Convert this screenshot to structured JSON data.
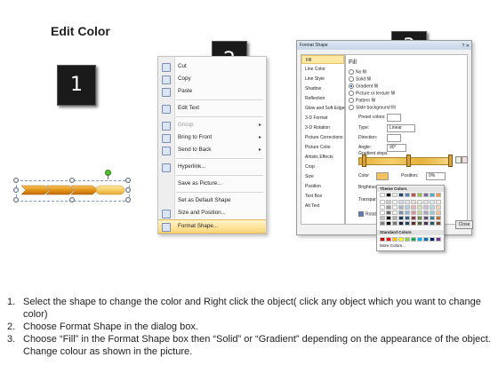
{
  "title": "Edit Color",
  "badges": [
    "1",
    "2",
    "3"
  ],
  "context_menu": {
    "items": [
      {
        "label": "Cut",
        "disabled": false
      },
      {
        "label": "Copy",
        "disabled": false
      },
      {
        "label": "Paste",
        "disabled": false
      },
      {
        "label": "Edit Text",
        "disabled": false
      },
      {
        "label": "Group",
        "disabled": true,
        "submenu": true
      },
      {
        "label": "Bring to Front",
        "disabled": false,
        "submenu": true
      },
      {
        "label": "Send to Back",
        "disabled": false,
        "submenu": true
      },
      {
        "label": "Hyperlink...",
        "disabled": false
      },
      {
        "label": "Save as Picture...",
        "disabled": false
      },
      {
        "label": "Set as Default Shape",
        "disabled": false
      },
      {
        "label": "Size and Position...",
        "disabled": false
      },
      {
        "label": "Format Shape...",
        "disabled": false,
        "highlighted": true
      }
    ]
  },
  "format_dialog": {
    "title": "Format Shape",
    "sidebar": [
      "Fill",
      "Line Color",
      "Line Style",
      "Shadow",
      "Reflection",
      "Glow and Soft Edges",
      "3-D Format",
      "3-D Rotation",
      "Picture Corrections",
      "Picture Color",
      "Artistic Effects",
      "Crop",
      "Size",
      "Position",
      "Text Box",
      "Alt Text"
    ],
    "fill_heading": "Fill",
    "options": [
      "No fill",
      "Solid fill",
      "Gradient fill",
      "Picture or texture fill",
      "Pattern fill",
      "Slide background fill"
    ],
    "preset_label": "Preset colors:",
    "type_label": "Type:",
    "type_value": "Linear",
    "direction_label": "Direction:",
    "angle_label": "Angle:",
    "angle_value": "90°",
    "stops_label": "Gradient stops",
    "color_label": "Color",
    "position_label": "Position:",
    "position_value": "0%",
    "brightness_label": "Brightness",
    "transparency_label": "Transparen",
    "rotate_label": "Rotate",
    "close_label": "Close",
    "theme_colors_label": "Theme Colors",
    "standard_colors_label": "Standard Colors",
    "more_colors_label": "More Colors...",
    "theme_top": [
      "#ffffff",
      "#000000",
      "#eeece1",
      "#1f497d",
      "#4f81bd",
      "#c0504d",
      "#9bbb59",
      "#8064a2",
      "#4bacc6",
      "#f79646"
    ],
    "standard": [
      "#c00000",
      "#ff0000",
      "#ffc000",
      "#ffff00",
      "#92d050",
      "#00b050",
      "#00b0f0",
      "#0070c0",
      "#002060",
      "#7030a0"
    ]
  },
  "instructions": [
    {
      "num": "1.",
      "text": "Select the shape to change the color and Right click the object( click any object which you want to change color)"
    },
    {
      "num": "2.",
      "text": "Choose Format Shape in the dialog box."
    },
    {
      "num": "3.",
      "text": "Choose “Fill” in the Format Shape box then “Solid” or “Gradient” depending on the appearance of the object. Change colour as shown in the picture."
    }
  ]
}
